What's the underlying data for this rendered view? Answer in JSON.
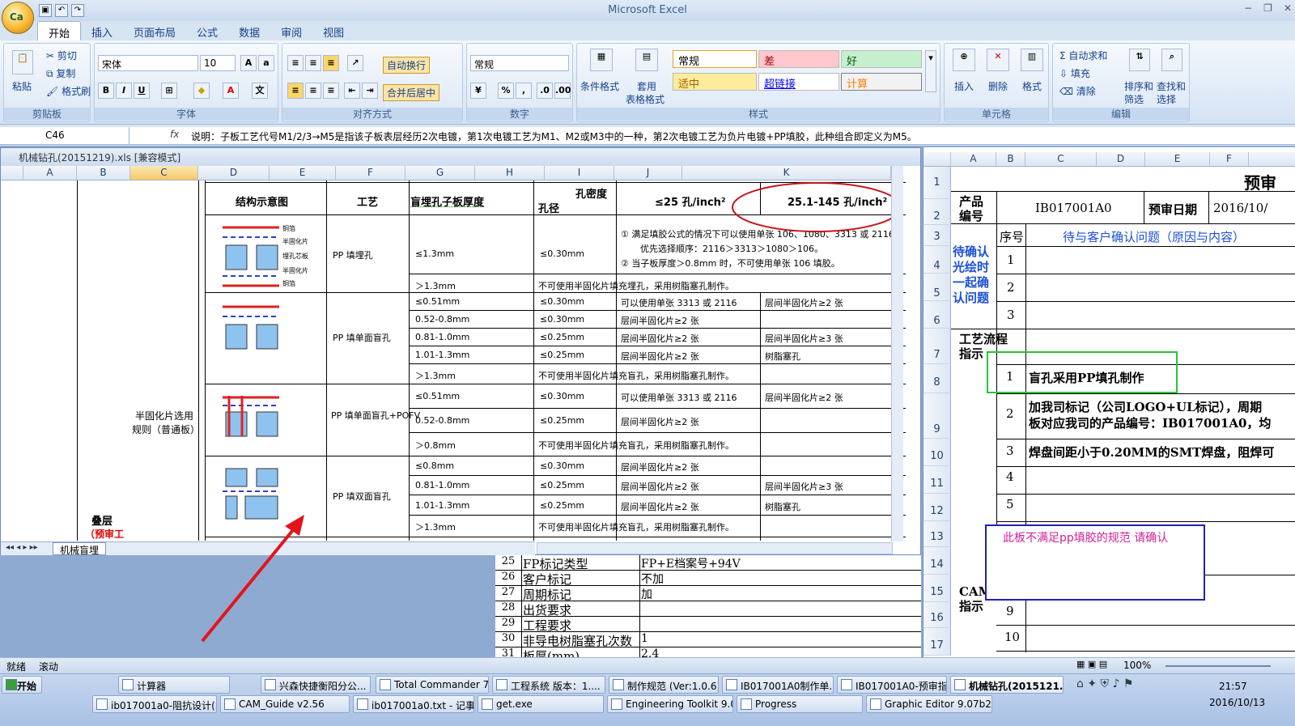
{
  "app_title": "Microsoft Excel",
  "qat_icons": [
    "save-icon",
    "undo-icon",
    "redo-icon"
  ],
  "tabs": [
    "开始",
    "插入",
    "页面布局",
    "公式",
    "数据",
    "审阅",
    "视图"
  ],
  "ribbon": {
    "clipboard": {
      "paste": "粘贴",
      "cut": "剪切",
      "copy": "复制",
      "format_painter": "格式刷",
      "label": "剪贴板"
    },
    "font": {
      "name": "宋体",
      "size": "10",
      "label": "字体"
    },
    "align": {
      "wrap": "自动换行",
      "merge": "合并后居中",
      "label": "对齐方式"
    },
    "number": {
      "format": "常规",
      "label": "数字"
    },
    "styles": {
      "cond": "条件格式",
      "table": "套用",
      "table2": "表格格式",
      "normal": "常规",
      "bad": "差",
      "good": "好",
      "neutral": "适中",
      "hyperlink": "超链接",
      "calc": "计算",
      "label": "样式"
    },
    "cells": {
      "insert": "插入",
      "delete": "删除",
      "format": "格式",
      "label": "单元格"
    },
    "editing": {
      "autosum": "自动求和",
      "fill": "填充",
      "clear": "清除",
      "sort": "排序和",
      "sort2": "筛选",
      "find": "查找和",
      "find2": "选择",
      "label": "编辑"
    }
  },
  "formula_bar": {
    "name_box": "C46",
    "fx": "fx",
    "content": "说明：子板工艺代号M1/2/3→M5是指该子板表层经历2次电镀，第1次电镀工艺为M1、M2或M3中的一种，第2次电镀工艺为负片电镀+PP填胶，此种组合即定义为M5。"
  },
  "win1": {
    "title": "机械钻孔(20151219).xls  [兼容模式]",
    "columns": [
      "A",
      "B",
      "C",
      "D",
      "E",
      "F",
      "G",
      "H",
      "I",
      "J",
      "K"
    ],
    "sheet_tab": "机械盲埋",
    "header": {
      "diagram": "结构示意图",
      "process": "工艺",
      "thickness": "盲埋孔子板厚度",
      "density": "孔密度",
      "hole": "孔径",
      "le25": "≤25 孔/inch²",
      "range": "25.1-145 孔/inch²"
    },
    "side_label": "半固化片选用规则（普通板）",
    "bottom_label1": "叠层",
    "bottom_label2": "（预审工",
    "layer_labels": [
      "铜箔",
      "半固化片",
      "埋孔芯板",
      "半固化片",
      "铜箔"
    ],
    "sections": [
      {
        "process": "PP 填埋孔",
        "rows": [
          {
            "t": "≤1.3mm",
            "h": "≤0.30mm",
            "a": "① 满足填胶公式的情况下可以使用单张 106、1080、3313 或 2116",
            "a2": "优先选择顺序：2116＞3313＞1080＞106。",
            "a3": "② 当子板厚度＞0.8mm 时，不可使用单张 106 填胶。",
            "b": ""
          },
          {
            "t": "＞1.3mm",
            "full": "不可使用半固化片填充埋孔，采用树脂塞孔制作。"
          }
        ]
      },
      {
        "process": "PP 填单面盲孔",
        "rows": [
          {
            "t": "≤0.51mm",
            "h": "≤0.30mm",
            "a": "可以使用单张 3313 或 2116",
            "b": "层间半固化片≥2 张"
          },
          {
            "t": "0.52-0.8mm",
            "h": "≤0.30mm",
            "a": "层间半固化片≥2 张",
            "b": ""
          },
          {
            "t": "0.81-1.0mm",
            "h": "≤0.25mm",
            "a": "层间半固化片≥2 张",
            "b": "层间半固化片≥3 张"
          },
          {
            "t": "1.01-1.3mm",
            "h": "≤0.25mm",
            "a": "层间半固化片≥2 张",
            "b": "树脂塞孔"
          },
          {
            "t": "＞1.3mm",
            "full": "不可使用半固化片填充盲孔，采用树脂塞孔制作。"
          }
        ]
      },
      {
        "process": "PP 填单面盲孔+POFV",
        "rows": [
          {
            "t": "≤0.51mm",
            "h": "≤0.30mm",
            "a": "可以使用单张 3313 或 2116",
            "b": "层间半固化片≥2 张"
          },
          {
            "t": "0.52-0.8mm",
            "h": "≤0.25mm",
            "a": "层间半固化片≥2 张",
            "b": ""
          },
          {
            "t": "＞0.8mm",
            "full": "不可使用半固化片填充盲孔，采用树脂塞孔制作。"
          }
        ]
      },
      {
        "process": "PP 填双面盲孔",
        "rows": [
          {
            "t": "≤0.8mm",
            "h": "≤0.30mm",
            "a": "层间半固化片≥2 张",
            "b": ""
          },
          {
            "t": "0.81-1.0mm",
            "h": "≤0.25mm",
            "a": "层间半固化片≥2 张",
            "b": "层间半固化片≥3 张"
          },
          {
            "t": "1.01-1.3mm",
            "h": "≤0.25mm",
            "a": "层间半固化片≥2 张",
            "b": "树脂塞孔"
          },
          {
            "t": "＞1.3mm",
            "full": "不可使用半固化片填充盲孔，采用树脂塞孔制作。"
          }
        ]
      }
    ]
  },
  "mid_rows": [
    {
      "n": "25",
      "k": "FP标记类型",
      "v": "FP+E档案号+94V"
    },
    {
      "n": "26",
      "k": "客户标记",
      "v": "不加"
    },
    {
      "n": "27",
      "k": "周期标记",
      "v": "加"
    },
    {
      "n": "28",
      "k": "出货要求",
      "v": ""
    },
    {
      "n": "29",
      "k": "工程要求",
      "v": ""
    },
    {
      "n": "30",
      "k": "非导电树脂塞孔次数",
      "v": "1"
    },
    {
      "n": "31",
      "k": "板厚(mm)",
      "v": "2.4"
    }
  ],
  "win2": {
    "columns": [
      "A",
      "B",
      "C",
      "D",
      "E",
      "F"
    ],
    "title_partial": "预审",
    "product_no_label": "产品编号",
    "product_no": "IB017001A0",
    "prereview_date_label": "预审日期",
    "prereview_date": "2016/10/",
    "seq": "序号",
    "confirm_header": "待与客户确认问题（原因与内容）",
    "left_label": "待确认光绘时一起确认问题",
    "flow_label": "工艺流程指示",
    "cam_label": "CAM指示",
    "items": [
      {
        "n": "1",
        "t": "盲孔采用PP填孔制作"
      },
      {
        "n": "2",
        "t": "加我司标记（公司LOGO+UL标记），周期",
        "t2": "板对应我司的产品编号：IB017001A0，均"
      },
      {
        "n": "3",
        "t": "焊盘间距小于0.20MM的SMT焊盘，阻焊可"
      },
      {
        "n": "4",
        "t": ""
      },
      {
        "n": "5",
        "t": ""
      },
      {
        "n": "9",
        "t": ""
      },
      {
        "n": "10",
        "t": ""
      }
    ],
    "comment": "此板不满足pp填胶的规范 请确认",
    "row_numbers": [
      "1",
      "2",
      "3",
      "4",
      "5",
      "6",
      "7",
      "8",
      "9",
      "10",
      "11",
      "12",
      "13",
      "14",
      "15",
      "16",
      "17"
    ]
  },
  "status": {
    "ready": "就绪",
    "scroll": "滚动",
    "zoom": "100%"
  },
  "taskbar": {
    "start": "开始",
    "row1": [
      "计算器",
      "兴森快捷衡阳分公...",
      "Total Commander 7.0...",
      "工程系统  版本：1....",
      "制作规范 (Ver:1.0.6)",
      "IB017001A0制作单....",
      "IB017001A0-预审指...",
      "机械钻孔(2015121..."
    ],
    "row2": [
      "ib017001a0-阻抗设计(N...",
      "CAM_Guide v2.56",
      "ib017001a0.txt - 记事本",
      "get.exe",
      "Engineering Toolkit 9.07...",
      "Progress",
      "Graphic Editor 9.07b2 (0..."
    ],
    "time": "21:57",
    "date": "2016/10/13"
  },
  "colors": {
    "highlight_green": "#27c43b",
    "comment_blue": "#1f1fbf",
    "comment_text": "#d0209a",
    "oval_red": "#c4161c",
    "arrow_red": "#e3141c",
    "label_red": "#e00000",
    "label_blue": "#1a4fd8"
  }
}
